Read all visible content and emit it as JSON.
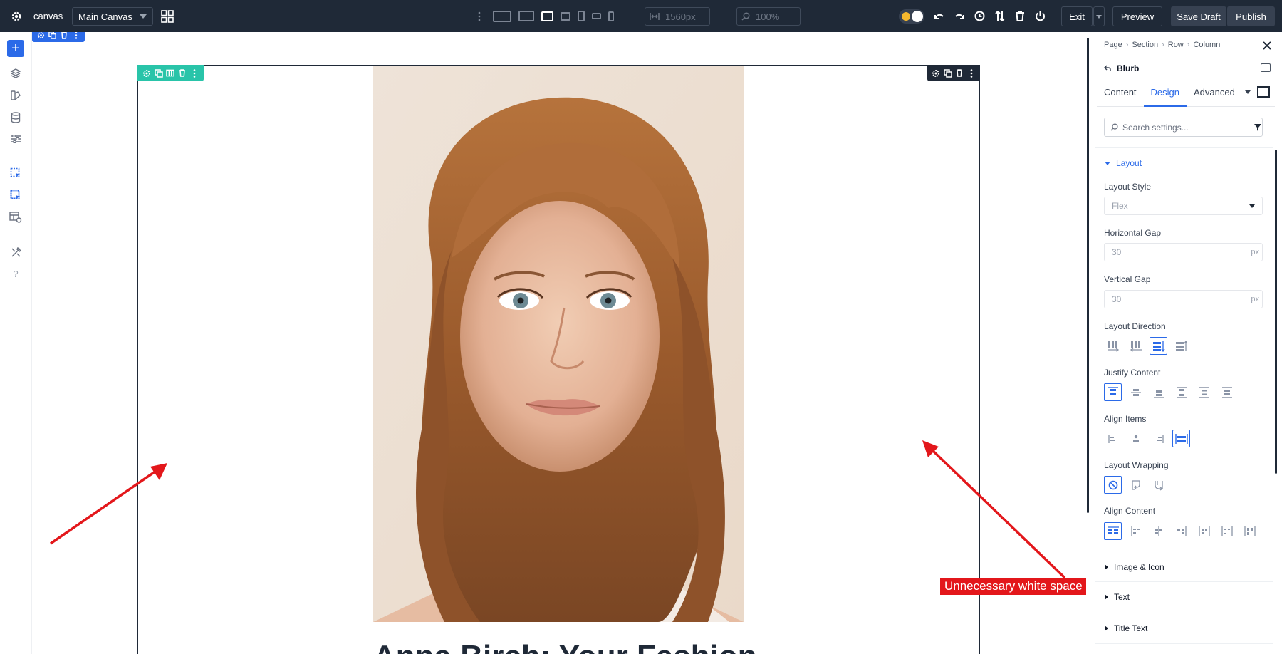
{
  "topbar": {
    "app_label": "canvas",
    "canvas_select": "Main Canvas",
    "width_value": "1560px",
    "zoom_value": "100%",
    "exit_label": "Exit",
    "preview_label": "Preview",
    "save_draft_label": "Save Draft",
    "publish_label": "Publish",
    "device_icons": [
      "desktop-wide-icon",
      "desktop-icon",
      "laptop-icon",
      "tablet-landscape-icon",
      "tablet-icon",
      "phone-landscape-icon",
      "phone-icon"
    ],
    "active_device": "laptop-icon"
  },
  "leftbar": {
    "items": [
      "add-icon",
      "layers-icon",
      "theme-icon",
      "database-icon",
      "sliders-icon",
      "page-select-icon",
      "pages-select-icon",
      "layout-settings-icon",
      "tools-icon",
      "help-icon"
    ]
  },
  "canvas": {
    "heading_text": "Anna Birch: Your Fashion",
    "annotation_label": "Unnecessary white space",
    "annotation_color": "#e3171b"
  },
  "panel": {
    "breadcrumb": [
      "Page",
      "Section",
      "Row",
      "Column"
    ],
    "module_name": "Blurb",
    "tabs": [
      "Content",
      "Design",
      "Advanced"
    ],
    "active_tab": "Design",
    "search_placeholder": "Search settings...",
    "layout_group": "Layout",
    "layout_style_label": "Layout Style",
    "layout_style_value": "Flex",
    "horizontal_gap_label": "Horizontal Gap",
    "horizontal_gap_value": "30",
    "horizontal_gap_unit": "px",
    "vertical_gap_label": "Vertical Gap",
    "vertical_gap_value": "30",
    "vertical_gap_unit": "px",
    "layout_direction_label": "Layout Direction",
    "justify_content_label": "Justify Content",
    "align_items_label": "Align Items",
    "layout_wrapping_label": "Layout Wrapping",
    "align_content_label": "Align Content",
    "collapsed_groups": [
      "Image & Icon",
      "Text",
      "Title Text"
    ]
  },
  "colors": {
    "accent": "#2b6ae8",
    "row_toolbar": "#29c4a9",
    "topbar_bg": "#1f2937"
  }
}
